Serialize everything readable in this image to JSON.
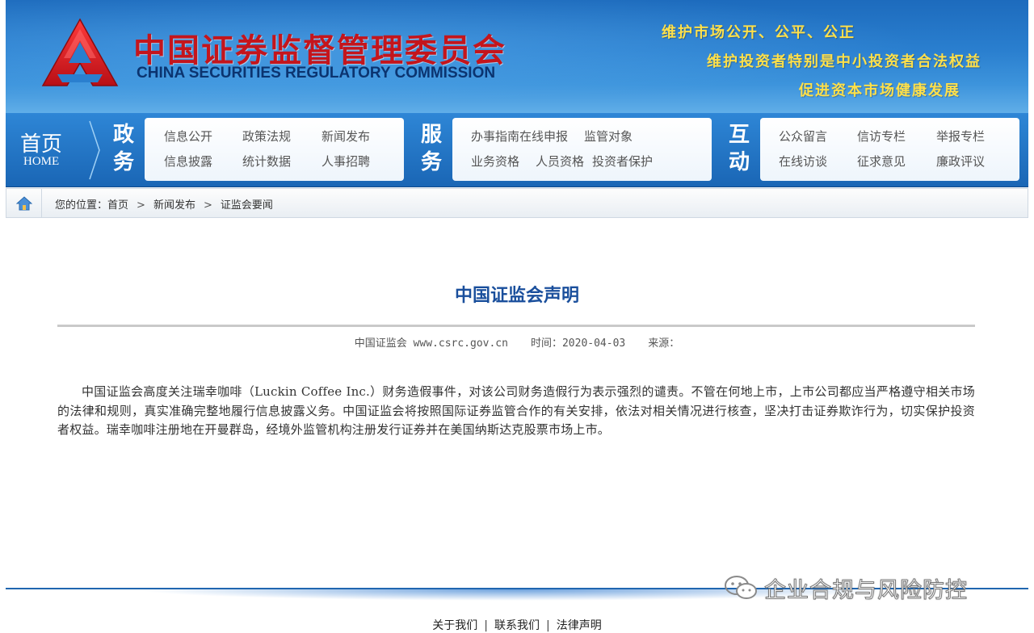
{
  "colors": {
    "banner_blue": "#2a7fcf",
    "title_red": "#c4151c",
    "slogan_yellow": "#ffe04a",
    "article_title_blue": "#1a4f9c"
  },
  "header": {
    "title_cn": "中国证券监督管理委员会",
    "title_en": "CHINA SECURITIES REGULATORY COMMISSION",
    "slogans": [
      "维护市场公开、公平、公正",
      "维护投资者特别是中小投资者合法权益",
      "促进资本市场健康发展"
    ]
  },
  "nav": {
    "home_cn": "首页",
    "home_en": "HOME",
    "sections": [
      {
        "label_top": "政",
        "label_bottom": "务",
        "links": [
          "信息公开",
          "政策法规",
          "新闻发布",
          "信息披露",
          "统计数据",
          "人事招聘"
        ]
      },
      {
        "label_top": "服",
        "label_bottom": "务",
        "links": [
          "办事指南",
          "在线申报",
          "监管对象",
          "业务资格",
          "人员资格",
          "投资者保护"
        ]
      },
      {
        "label_top": "互",
        "label_bottom": "动",
        "links": [
          "公众留言",
          "信访专栏",
          "举报专栏",
          "在线访谈",
          "征求意见",
          "廉政评议"
        ]
      }
    ]
  },
  "breadcrumb": {
    "icon": "home-icon",
    "prefix": "您的位置：",
    "items": [
      "首页",
      "新闻发布",
      "证监会要闻"
    ],
    "separator": ">"
  },
  "article": {
    "title": "中国证监会声明",
    "meta": {
      "site": "中国证监会 www.csrc.gov.cn",
      "time": "时间：2020-04-03",
      "source": "来源："
    },
    "body": "中国证监会高度关注瑞幸咖啡（Luckin Coffee Inc.）财务造假事件，对该公司财务造假行为表示强烈的谴责。不管在何地上市，上市公司都应当严格遵守相关市场的法律和规则，真实准确完整地履行信息披露义务。中国证监会将按照国际证券监管合作的有关安排，依法对相关情况进行核查，坚决打击证券欺诈行为，切实保护投资者权益。瑞幸咖啡注册地在开曼群岛，经境外监管机构注册发行证券并在美国纳斯达克股票市场上市。"
  },
  "footer": {
    "links": [
      "关于我们",
      "联系我们",
      "法律声明"
    ],
    "separator": "|"
  },
  "watermark": {
    "icon": "wechat-icon",
    "text": "企业合规与风险防控"
  }
}
